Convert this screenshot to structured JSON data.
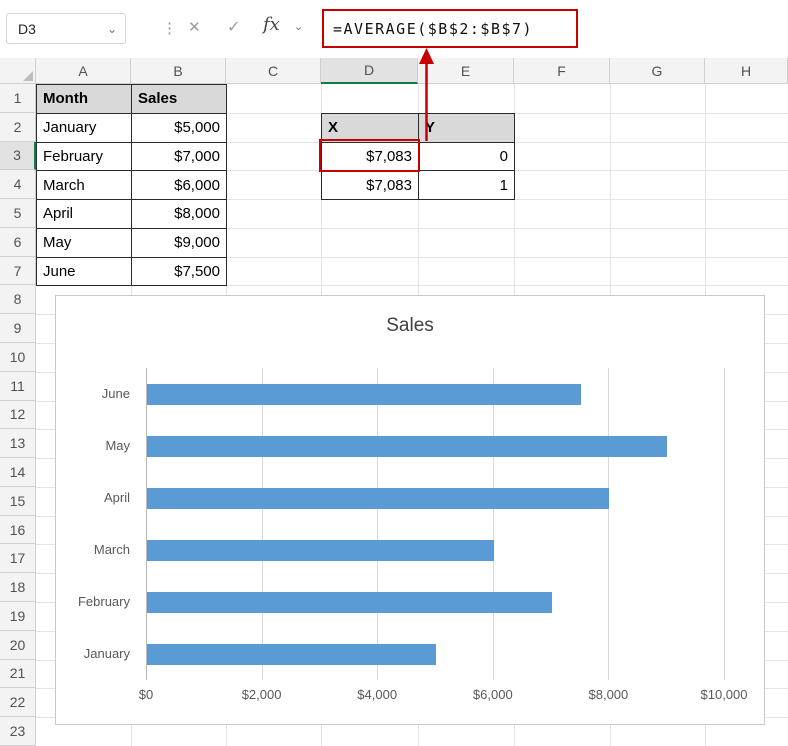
{
  "formula_bar": {
    "name_box_value": "D3",
    "name_box_chevron": "⌄",
    "separator_dots": "⋮",
    "cancel_icon": "✕",
    "enter_icon": "✓",
    "fx_icon": "fx",
    "fx_chevron": "⌄",
    "formula": "=AVERAGE($B$2:$B$7)"
  },
  "grid": {
    "column_headers": [
      "A",
      "B",
      "C",
      "D",
      "E",
      "F",
      "G",
      "H"
    ],
    "row_count": 23,
    "selected_cell": "D3",
    "selected_column": "D",
    "selected_row": 3
  },
  "tables": {
    "month_sales": {
      "headers": [
        "Month",
        "Sales"
      ],
      "rows": [
        [
          "January",
          "$5,000"
        ],
        [
          "February",
          "$7,000"
        ],
        [
          "March",
          "$6,000"
        ],
        [
          "April",
          "$8,000"
        ],
        [
          "May",
          "$9,000"
        ],
        [
          "June",
          "$7,500"
        ]
      ]
    },
    "xy": {
      "headers": [
        "X",
        "Y"
      ],
      "rows": [
        [
          "$7,083",
          "0"
        ],
        [
          "$7,083",
          "1"
        ]
      ]
    }
  },
  "chart_data": {
    "type": "bar",
    "orientation": "horizontal",
    "title": "Sales",
    "categories": [
      "June",
      "May",
      "April",
      "March",
      "February",
      "January"
    ],
    "values": [
      7500,
      9000,
      8000,
      6000,
      7000,
      5000
    ],
    "xlim": [
      0,
      10000
    ],
    "x_ticks": [
      {
        "value": 0,
        "label": "$0"
      },
      {
        "value": 2000,
        "label": "$2,000"
      },
      {
        "value": 4000,
        "label": "$4,000"
      },
      {
        "value": 6000,
        "label": "$6,000"
      },
      {
        "value": 8000,
        "label": "$8,000"
      },
      {
        "value": 10000,
        "label": "$10,000"
      }
    ],
    "bar_color": "#5B9BD5",
    "grid": true,
    "legend": false
  },
  "colors": {
    "annotation_red": "#C80000",
    "selection_green": "#107C41",
    "table_header_fill": "#D9D9D9",
    "bar_fill": "#5B9BD5"
  }
}
